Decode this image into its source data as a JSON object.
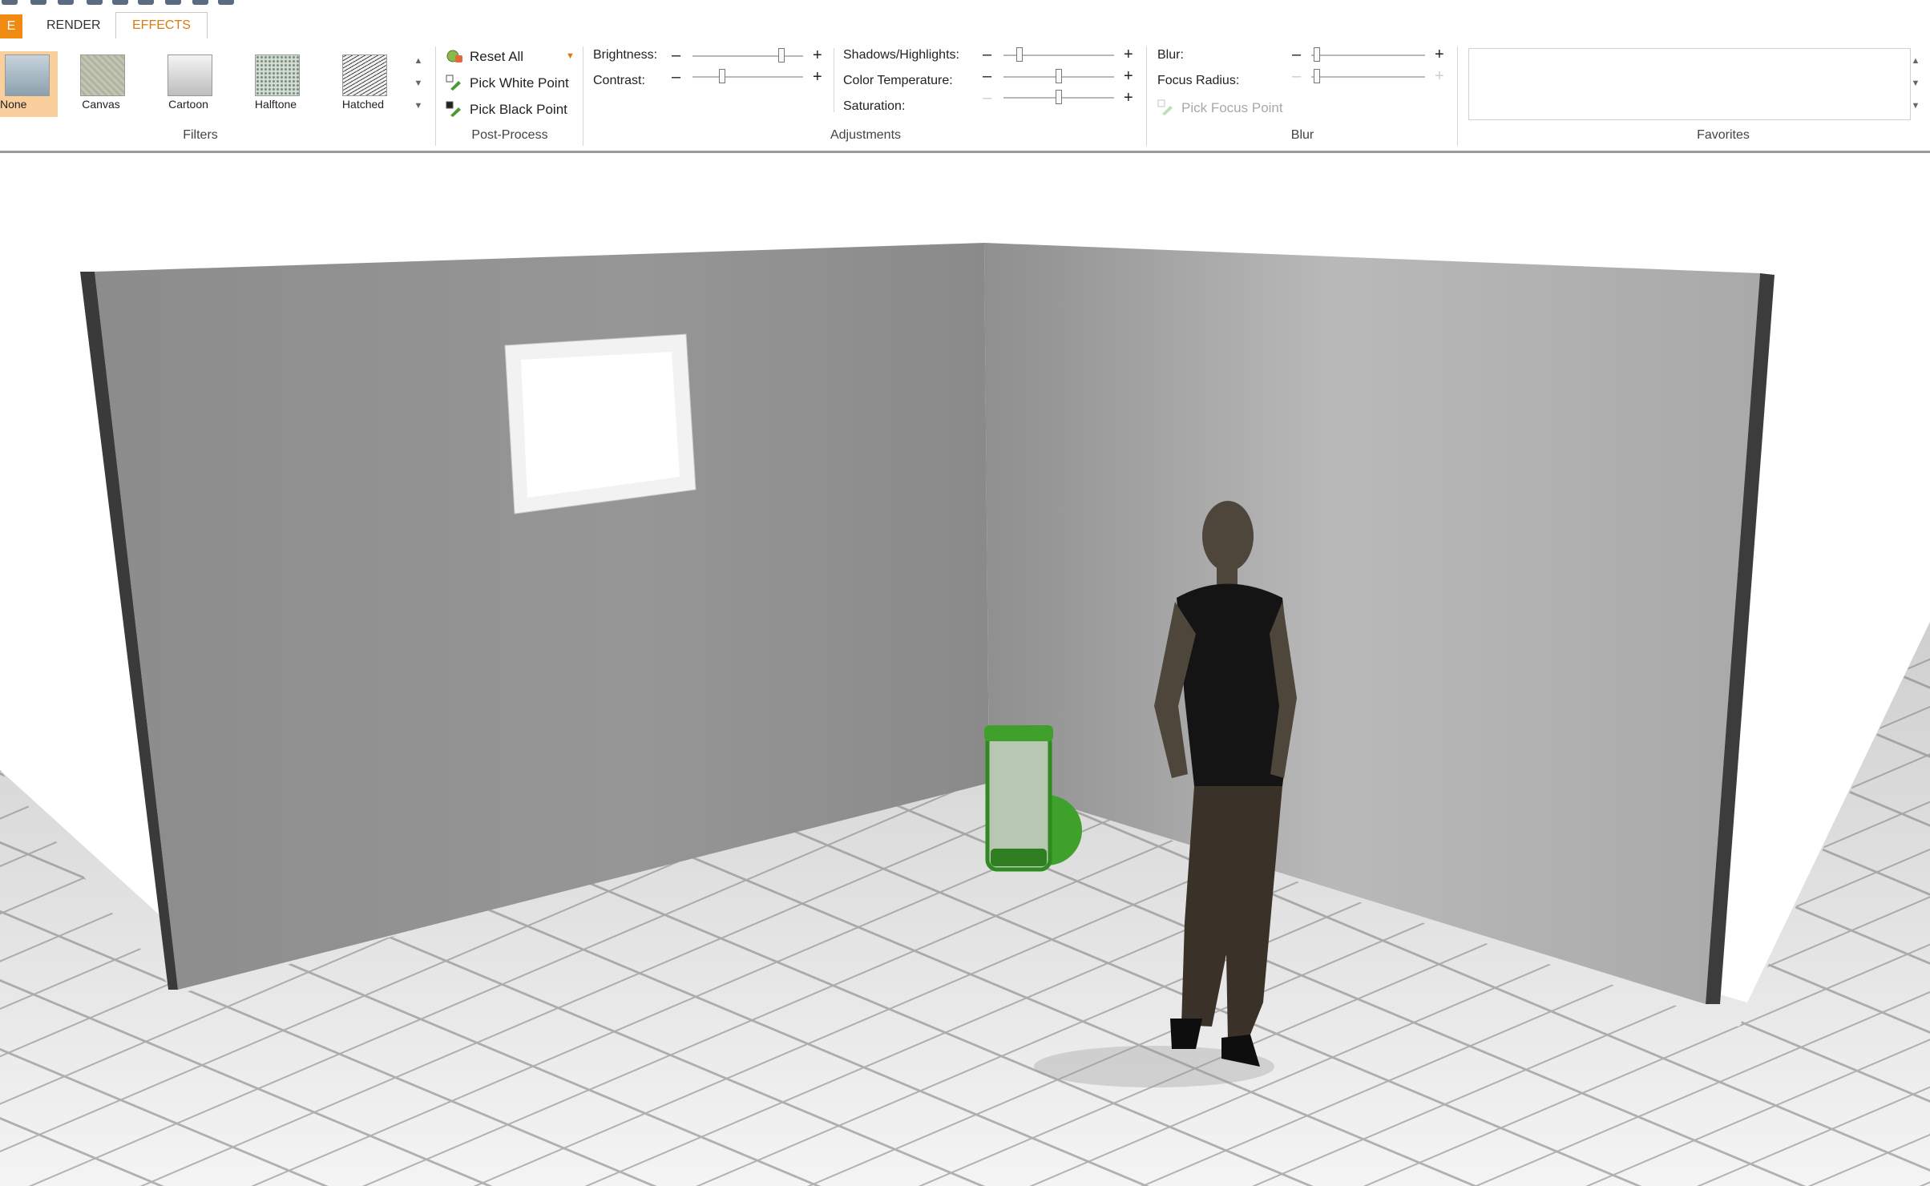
{
  "tabs": {
    "file_label": "E",
    "render": "RENDER",
    "effects": "EFFECTS"
  },
  "filters": {
    "group_title": "Filters",
    "items": [
      {
        "label": "None",
        "selected": true
      },
      {
        "label": "Canvas"
      },
      {
        "label": "Cartoon"
      },
      {
        "label": "Halftone"
      },
      {
        "label": "Hatched"
      }
    ]
  },
  "post_process": {
    "group_title": "Post-Process",
    "reset_all": "Reset All",
    "pick_white_point": "Pick White Point",
    "pick_black_point": "Pick Black Point"
  },
  "adjustments": {
    "group_title": "Adjustments",
    "brightness": {
      "label": "Brightness:",
      "value": 0.82
    },
    "contrast": {
      "label": "Contrast:",
      "value": 0.25
    },
    "shadows_highlights": {
      "label": "Shadows/Highlights:",
      "value": 0.12
    },
    "color_temperature": {
      "label": "Color Temperature:",
      "value": 0.5
    },
    "saturation": {
      "label": "Saturation:",
      "value": 0.5
    },
    "minus": "–",
    "plus": "+"
  },
  "blur": {
    "group_title": "Blur",
    "blur": {
      "label": "Blur:",
      "value": 0.02
    },
    "focus_radius": {
      "label": "Focus Radius:",
      "value": 0.02
    },
    "pick_focus_point": "Pick Focus Point"
  },
  "favorites": {
    "group_title": "Favorites"
  },
  "colors": {
    "accent": "#f08a12",
    "selected_filter": "#f9cf9e",
    "lamp_green": "#3fa12c"
  }
}
